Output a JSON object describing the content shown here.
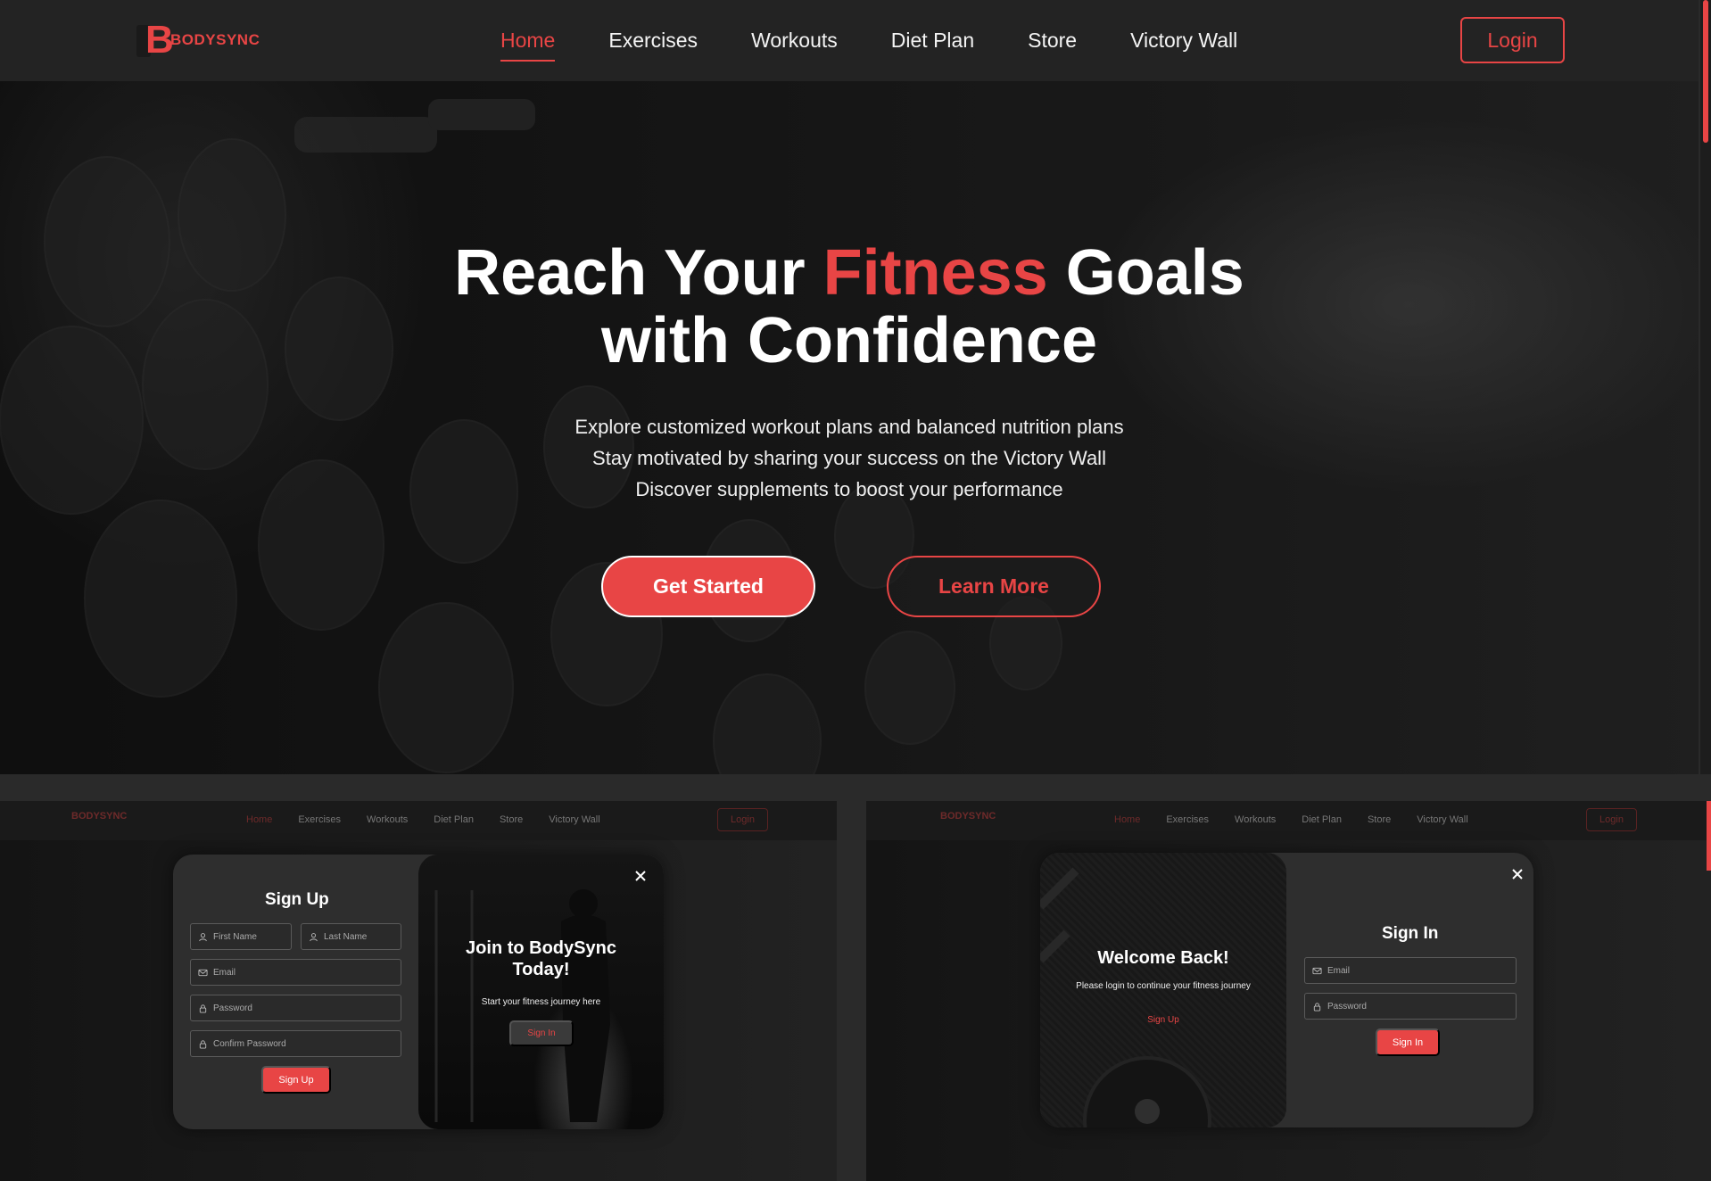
{
  "brand": {
    "name": "BODYSYNC"
  },
  "nav": {
    "items": [
      {
        "label": "Home",
        "active": true
      },
      {
        "label": "Exercises"
      },
      {
        "label": "Workouts"
      },
      {
        "label": "Diet Plan"
      },
      {
        "label": "Store"
      },
      {
        "label": "Victory Wall"
      }
    ],
    "login_label": "Login"
  },
  "hero": {
    "title_part1": "Reach Your ",
    "title_accent": "Fitness",
    "title_part2": " Goals",
    "title_line2": "with Confidence",
    "subtitle_lines": [
      "Explore customized workout plans and balanced nutrition plans",
      "Stay motivated by sharing your success on the Victory Wall",
      "Discover supplements to boost your performance"
    ],
    "get_started_label": "Get Started",
    "learn_more_label": "Learn More"
  },
  "signup_modal": {
    "title": "Sign Up",
    "first_name_placeholder": "First Name",
    "last_name_placeholder": "Last Name",
    "email_placeholder": "Email",
    "password_placeholder": "Password",
    "confirm_password_placeholder": "Confirm Password",
    "submit_label": "Sign Up",
    "side_title": "Join to BodySync Today!",
    "side_subtitle": "Start your fitness journey here",
    "side_button_label": "Sign In"
  },
  "signin_modal": {
    "title": "Sign In",
    "email_placeholder": "Email",
    "password_placeholder": "Password",
    "submit_label": "Sign In",
    "side_title": "Welcome Back!",
    "side_subtitle": "Please login to continue your fitness journey",
    "side_link_label": "Sign Up"
  },
  "colors": {
    "accent": "#e84545",
    "navbar": "#232323",
    "modal": "#2e2e2e"
  },
  "icons": [
    "user-icon",
    "mail-icon",
    "lock-icon",
    "close-icon"
  ]
}
